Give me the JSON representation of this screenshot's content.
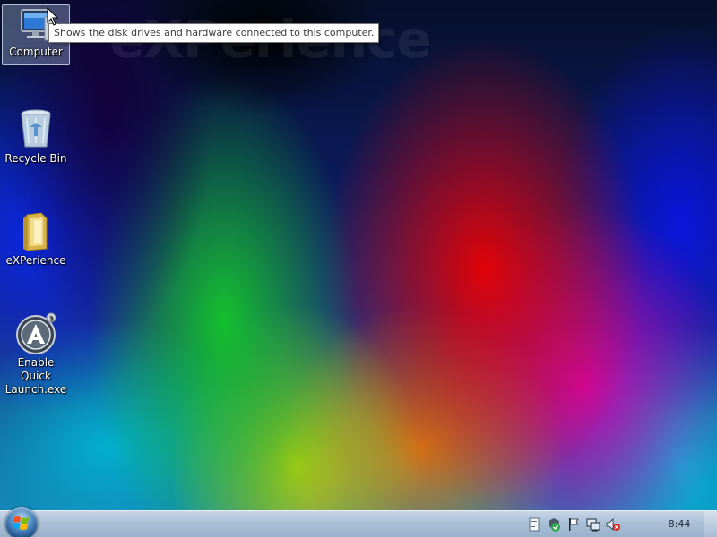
{
  "wallpaper": {
    "watermark": "eXPerience"
  },
  "desktop": {
    "icons": [
      {
        "label": "Computer",
        "icon": "computer-icon",
        "selected": true
      },
      {
        "label": "Recycle Bin",
        "icon": "recycle-bin-icon"
      },
      {
        "label": "eXPerience",
        "icon": "folder-icon"
      },
      {
        "label": "Enable Quick\nLaunch.exe",
        "icon": "aimp-app-icon"
      }
    ]
  },
  "tooltip": {
    "text": "Shows the disk drives and hardware connected to this computer."
  },
  "taskbar": {
    "start_button": "start-orb-icon",
    "tray_icons": [
      "notes-icon",
      "security-check-icon",
      "action-center-flag-icon",
      "network-icon",
      "volume-muted-icon"
    ],
    "clock": "8:44"
  },
  "colors": {
    "taskbar": "#a9bfd6",
    "tooltip_border": "#767676"
  }
}
